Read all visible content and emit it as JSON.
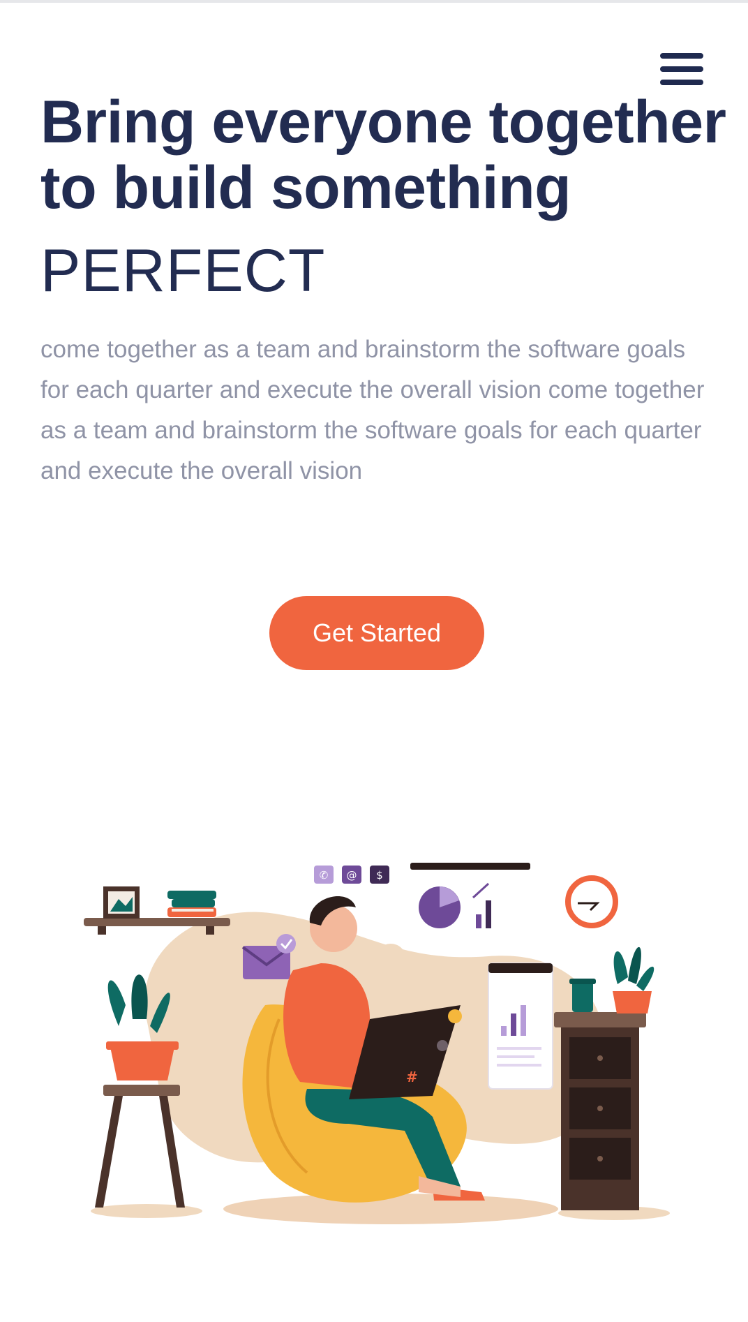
{
  "header": {
    "menu_icon": "hamburger-menu-icon"
  },
  "hero": {
    "title": "Bring everyone together to build something",
    "subtitle": "PERFECT",
    "description": "come together as a team and brainstorm the software goals for each quarter and execute the overall vision come together as a team and brainstorm the software goals for each quarter and execute the overall vision",
    "cta_label": "Get Started"
  },
  "illustration": {
    "name": "person-working-on-laptop-illustration",
    "icons": [
      "phone-icon",
      "at-icon",
      "dollar-icon",
      "mail-icon",
      "clock-icon",
      "pie-chart-icon",
      "bar-chart-icon"
    ]
  },
  "colors": {
    "heading": "#222c51",
    "body_text": "#8f93a6",
    "accent": "#f0653f"
  }
}
